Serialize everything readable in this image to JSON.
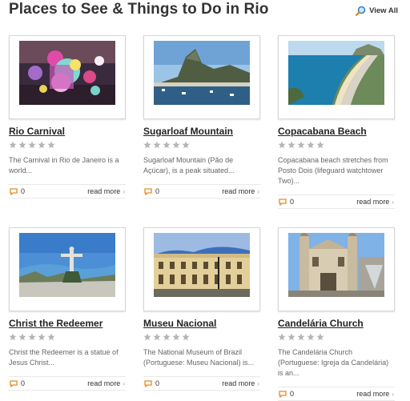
{
  "header": {
    "title": "Places to See & Things to Do in Rio",
    "view_all": "View All"
  },
  "colors": {
    "accent_orange": "#e68a1e",
    "star_gray": "#b5b5b5"
  },
  "cards": [
    {
      "title": "Rio Carnival",
      "desc": "The Carnival in Rio de Janeiro is a world...",
      "comments": "0",
      "read_more": "read more",
      "rating": 0,
      "image": "carnival parade float"
    },
    {
      "title": "Sugarloaf Mountain",
      "desc": "Sugarloaf Mountain (Pão de Açúcar), is a peak situated...",
      "comments": "0",
      "read_more": "read more",
      "rating": 0,
      "image": "sugarloaf mountain over bay"
    },
    {
      "title": "Copacabana Beach",
      "desc": "Copacabana beach stretches from Posto Dois (lifeguard watchtower Two)...",
      "comments": "0",
      "read_more": "read more",
      "rating": 0,
      "image": "copacabana beach aerial"
    },
    {
      "title": "Christ the Redeemer",
      "desc": "Christ the Redeemer is a statue of Jesus Christ...",
      "comments": "0",
      "read_more": "read more",
      "rating": 0,
      "image": "christ the redeemer statue"
    },
    {
      "title": "Museu Nacional",
      "desc": "The National Museum of Brazil (Portuguese: Museu Nacional) is...",
      "comments": "0",
      "read_more": "read more",
      "rating": 0,
      "image": "national museum building"
    },
    {
      "title": "Candelária Church",
      "desc": "The Candelária Church (Portuguese: Igreja da Candelária) is an...",
      "comments": "0",
      "read_more": "read more",
      "rating": 0,
      "image": "candelaria church facade"
    }
  ]
}
